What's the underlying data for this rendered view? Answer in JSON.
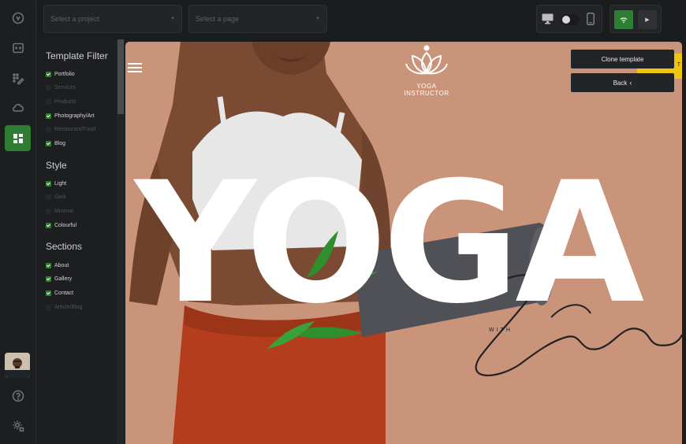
{
  "topbar": {
    "project_placeholder": "Select a project",
    "page_placeholder": "Select a page"
  },
  "filters": {
    "template_title": "Template Filter",
    "template_options": [
      {
        "label": "Portfolio",
        "checked": true
      },
      {
        "label": "Services",
        "checked": false
      },
      {
        "label": "Products",
        "checked": false
      },
      {
        "label": "Photography/Art",
        "checked": true
      },
      {
        "label": "Restaurant/Food",
        "checked": false
      },
      {
        "label": "Blog",
        "checked": true
      }
    ],
    "style_title": "Style",
    "style_options": [
      {
        "label": "Light",
        "checked": true
      },
      {
        "label": "Dark",
        "checked": false
      },
      {
        "label": "Minimal",
        "checked": false
      },
      {
        "label": "Colourful",
        "checked": true
      }
    ],
    "sections_title": "Sections",
    "sections_options": [
      {
        "label": "About",
        "checked": true
      },
      {
        "label": "Gallery",
        "checked": true
      },
      {
        "label": "Contact",
        "checked": true
      },
      {
        "label": "Article/Blog",
        "checked": false
      }
    ]
  },
  "preview": {
    "logo_text": "YOGA INSTRUCTOR",
    "hero_word": "YOGA",
    "with_text": "WITH",
    "script_name": "Simone",
    "bg_color": "#c99479"
  },
  "actions": {
    "clone_label": "Clone template",
    "back_label": "Back",
    "tab_letter": "T"
  },
  "colors": {
    "accent": "#2e7d32",
    "highlight": "#f1c40f"
  }
}
